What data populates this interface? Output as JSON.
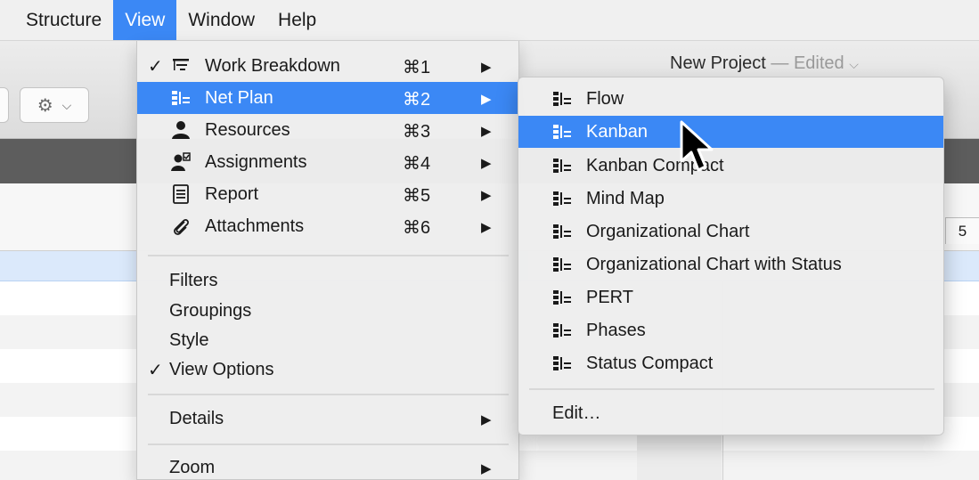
{
  "menubar": {
    "items": [
      "Structure",
      "View",
      "Window",
      "Help"
    ],
    "active": "View"
  },
  "window": {
    "title": "New Project",
    "status": "Edited",
    "column_number": "5"
  },
  "colors": {
    "accent": "#3b88f5",
    "menu_bg": "#eeeeee",
    "dark_bar": "#5d5d5d",
    "selected_row": "#dbe9fb"
  },
  "view_menu": {
    "items": [
      {
        "label": "Work Breakdown",
        "shortcut": "⌘1",
        "checked": true,
        "icon": "work-breakdown-icon",
        "submenu": true
      },
      {
        "label": "Net Plan",
        "shortcut": "⌘2",
        "checked": false,
        "icon": "net-plan-icon",
        "submenu": true,
        "highlighted": true
      },
      {
        "label": "Resources",
        "shortcut": "⌘3",
        "checked": false,
        "icon": "resources-icon",
        "submenu": true
      },
      {
        "label": "Assignments",
        "shortcut": "⌘4",
        "checked": false,
        "icon": "assignments-icon",
        "submenu": true
      },
      {
        "label": "Report",
        "shortcut": "⌘5",
        "checked": false,
        "icon": "report-icon",
        "submenu": true
      },
      {
        "label": "Attachments",
        "shortcut": "⌘6",
        "checked": false,
        "icon": "attachments-icon",
        "submenu": true
      }
    ],
    "options": [
      {
        "label": "Filters",
        "checked": false
      },
      {
        "label": "Groupings",
        "checked": false
      },
      {
        "label": "Style",
        "checked": false
      },
      {
        "label": "View Options",
        "checked": true
      }
    ],
    "details": {
      "label": "Details",
      "submenu": true
    },
    "zoom": {
      "label": "Zoom",
      "submenu": true
    }
  },
  "net_plan_submenu": {
    "items": [
      {
        "label": "Flow"
      },
      {
        "label": "Kanban",
        "highlighted": true
      },
      {
        "label": "Kanban Compact"
      },
      {
        "label": "Mind Map"
      },
      {
        "label": "Organizational Chart"
      },
      {
        "label": "Organizational Chart with Status"
      },
      {
        "label": "PERT"
      },
      {
        "label": "Phases"
      },
      {
        "label": "Status Compact"
      }
    ],
    "edit": "Edit…"
  }
}
